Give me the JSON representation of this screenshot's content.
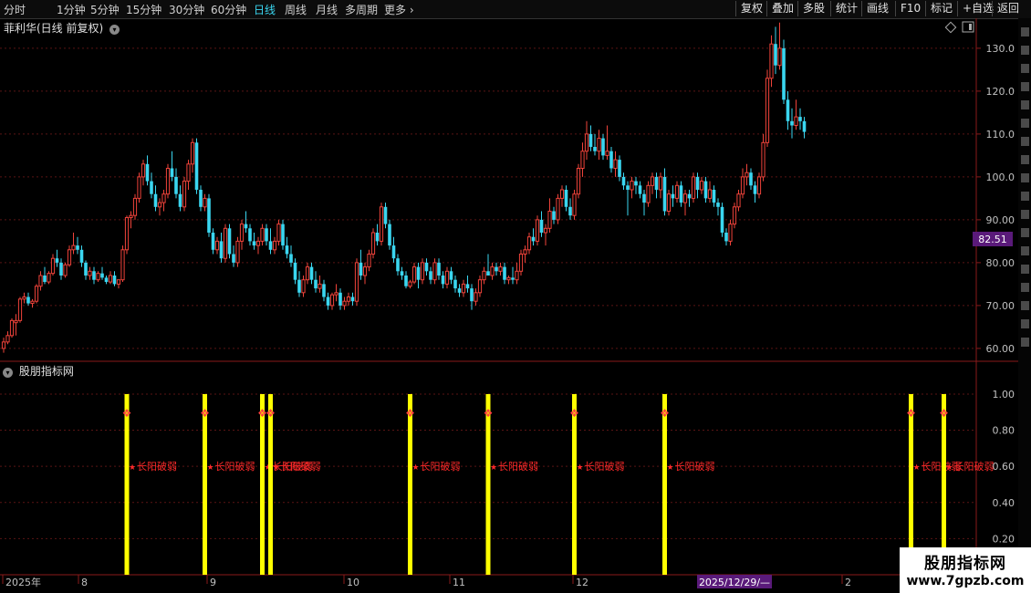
{
  "toolbar": {
    "periods": [
      {
        "label": "分时",
        "active": false
      },
      {
        "label": "1分钟",
        "active": false
      },
      {
        "label": "5分钟",
        "active": false
      },
      {
        "label": "15分钟",
        "active": false
      },
      {
        "label": "30分钟",
        "active": false
      },
      {
        "label": "60分钟",
        "active": false
      },
      {
        "label": "日线",
        "active": true
      },
      {
        "label": "周线",
        "active": false
      },
      {
        "label": "月线",
        "active": false
      },
      {
        "label": "多周期",
        "active": false
      },
      {
        "label": "更多",
        "active": false
      }
    ],
    "buttons": [
      "复权",
      "叠加",
      "多股",
      "统计",
      "画线",
      "F10",
      "标记",
      "+自选",
      "返回"
    ]
  },
  "main_panel": {
    "title": "菲利华(日线 前复权)",
    "price_tag": "82.51",
    "y_ticks": [
      "130.0",
      "120.0",
      "110.0",
      "100.0",
      "90.00",
      "80.00",
      "70.00",
      "60.00"
    ]
  },
  "indicator_panel": {
    "title": "股朋指标网",
    "y_ticks": [
      "1.00",
      "0.80",
      "0.60",
      "0.40",
      "0.20"
    ],
    "signal_label": "长阳破弱"
  },
  "x_axis": {
    "labels": [
      "2025年",
      "8",
      "9",
      "10",
      "11",
      "12",
      "2"
    ],
    "cursor_date": "2025/12/29/—"
  },
  "watermark": {
    "line1": "股朋指标网",
    "line2": "www.7gpzb.com"
  },
  "colors": {
    "up": "#f0433a",
    "down": "#3ad6f0",
    "signal_bar": "#ffff00",
    "signal_text": "#ff2a2a",
    "grid": "#5a1414",
    "axis_text": "#c0c0c0"
  },
  "chart_data": {
    "type": "candlestick",
    "ylim": [
      57,
      137
    ],
    "candles": [
      [
        60,
        62.5,
        59,
        61.5
      ],
      [
        61.5,
        64,
        61,
        63
      ],
      [
        63,
        67,
        62.5,
        66.5
      ],
      [
        66,
        68,
        63,
        66.5
      ],
      [
        66.5,
        72,
        66,
        71.5
      ],
      [
        71.5,
        73,
        70.5,
        72
      ],
      [
        72,
        73,
        70,
        70.5
      ],
      [
        70.5,
        71.5,
        69.5,
        71
      ],
      [
        71,
        75,
        70.5,
        74.5
      ],
      [
        74.5,
        78,
        73.5,
        77
      ],
      [
        77,
        79,
        75,
        75.5
      ],
      [
        75.5,
        78,
        75,
        77.5
      ],
      [
        77.5,
        82,
        77,
        81
      ],
      [
        81,
        83,
        79,
        80
      ],
      [
        80,
        81,
        76,
        77
      ],
      [
        77,
        80,
        76.5,
        79.5
      ],
      [
        79.5,
        84,
        79,
        83
      ],
      [
        83,
        87,
        82,
        84
      ],
      [
        84,
        86,
        82,
        83
      ],
      [
        83,
        84,
        79,
        80
      ],
      [
        80,
        80.5,
        76,
        77
      ],
      [
        77,
        79,
        76,
        78
      ],
      [
        78,
        79,
        75,
        76
      ],
      [
        76,
        78,
        75.5,
        77.5
      ],
      [
        77.5,
        79,
        76,
        76.5
      ],
      [
        76.5,
        77,
        75,
        75.5
      ],
      [
        75.5,
        78,
        75,
        77
      ],
      [
        77,
        78,
        74.5,
        75
      ],
      [
        75,
        76,
        74,
        76
      ],
      [
        76,
        84,
        75.5,
        83
      ],
      [
        83,
        91,
        82,
        90.5
      ],
      [
        90.5,
        92,
        88,
        91
      ],
      [
        91,
        96,
        90,
        95
      ],
      [
        95,
        101,
        94,
        100
      ],
      [
        100,
        104,
        98,
        103
      ],
      [
        103,
        105,
        98,
        99
      ],
      [
        99,
        101,
        95,
        96
      ],
      [
        96,
        98,
        92,
        93
      ],
      [
        93,
        95,
        91,
        94
      ],
      [
        94,
        97,
        92,
        96
      ],
      [
        96,
        103,
        95,
        102
      ],
      [
        102,
        106,
        99,
        100
      ],
      [
        100,
        102,
        95,
        96
      ],
      [
        96,
        98,
        92,
        93
      ],
      [
        93,
        100,
        92,
        99
      ],
      [
        99,
        104,
        97,
        103
      ],
      [
        103,
        109,
        101,
        108
      ],
      [
        108,
        109,
        96,
        97
      ],
      [
        97,
        98,
        92,
        93
      ],
      [
        93,
        96,
        92,
        95
      ],
      [
        95,
        96,
        86,
        87
      ],
      [
        87,
        88,
        82,
        83
      ],
      [
        83,
        86,
        82,
        85
      ],
      [
        85,
        87,
        80,
        81
      ],
      [
        81,
        89,
        80,
        88
      ],
      [
        88,
        89,
        81,
        82
      ],
      [
        82,
        84,
        79,
        80
      ],
      [
        80,
        86,
        79,
        85
      ],
      [
        85,
        90,
        83,
        89
      ],
      [
        89,
        92,
        87,
        88
      ],
      [
        88,
        89,
        84,
        85
      ],
      [
        85,
        87,
        83,
        84
      ],
      [
        84,
        86,
        82,
        85
      ],
      [
        85,
        89,
        84,
        88
      ],
      [
        88,
        89,
        84,
        85
      ],
      [
        85,
        88,
        82,
        83
      ],
      [
        83,
        86,
        82,
        85
      ],
      [
        85,
        90,
        84,
        89
      ],
      [
        89,
        90,
        83,
        84
      ],
      [
        84,
        86,
        81,
        82
      ],
      [
        82,
        84,
        79,
        80
      ],
      [
        80,
        81,
        75,
        76
      ],
      [
        76,
        78,
        72,
        73
      ],
      [
        73,
        77,
        72,
        76
      ],
      [
        76,
        80,
        75,
        79
      ],
      [
        79,
        80,
        75,
        76
      ],
      [
        76,
        78,
        73,
        74
      ],
      [
        74,
        77,
        73,
        75
      ],
      [
        75,
        76,
        71,
        72
      ],
      [
        72,
        73,
        69,
        70
      ],
      [
        70,
        73,
        69,
        72.5
      ],
      [
        72.5,
        75,
        71,
        73
      ],
      [
        73,
        74,
        69,
        70
      ],
      [
        70,
        72,
        69,
        71
      ],
      [
        71,
        73,
        70,
        72
      ],
      [
        72,
        73,
        70,
        71
      ],
      [
        71,
        81,
        70,
        80
      ],
      [
        80,
        83,
        76,
        77
      ],
      [
        77,
        80,
        75,
        79
      ],
      [
        79,
        83,
        78,
        82
      ],
      [
        82,
        88,
        81,
        87
      ],
      [
        87,
        89,
        84,
        85
      ],
      [
        85,
        94,
        84,
        93
      ],
      [
        93,
        94,
        88,
        89
      ],
      [
        89,
        90,
        83,
        84
      ],
      [
        84,
        86,
        80,
        81
      ],
      [
        81,
        82,
        77,
        78
      ],
      [
        78,
        79,
        76,
        77
      ],
      [
        77,
        78,
        74,
        74.5
      ],
      [
        74.5,
        76,
        74,
        75.5
      ],
      [
        75.5,
        80,
        75,
        79
      ],
      [
        79,
        80,
        74,
        76
      ],
      [
        76,
        81,
        75,
        80
      ],
      [
        80,
        81,
        77,
        78
      ],
      [
        78,
        79,
        75,
        76
      ],
      [
        76,
        81,
        75,
        80
      ],
      [
        80,
        81,
        76,
        77
      ],
      [
        77,
        78,
        74,
        75
      ],
      [
        75,
        79,
        74,
        78
      ],
      [
        78,
        79,
        75,
        76
      ],
      [
        76,
        77,
        73,
        74
      ],
      [
        74,
        75,
        72,
        73
      ],
      [
        73,
        76,
        72,
        75
      ],
      [
        75,
        77,
        73,
        74
      ],
      [
        74,
        75,
        69,
        71
      ],
      [
        71,
        74,
        70,
        73
      ],
      [
        73,
        77,
        72,
        76
      ],
      [
        76,
        79,
        75,
        78
      ],
      [
        78,
        82,
        77,
        77
      ],
      [
        77,
        80,
        76,
        79
      ],
      [
        79,
        80,
        77,
        78
      ],
      [
        78,
        80,
        77,
        79
      ],
      [
        79,
        80,
        75,
        76
      ],
      [
        76,
        77,
        75,
        76.5
      ],
      [
        76.5,
        79,
        75,
        76
      ],
      [
        76,
        80,
        75,
        78
      ],
      [
        78,
        83,
        77,
        82
      ],
      [
        82,
        84,
        80,
        83
      ],
      [
        83,
        87,
        82,
        86
      ],
      [
        86,
        88,
        84,
        85
      ],
      [
        85,
        91,
        84,
        90
      ],
      [
        90,
        92,
        86,
        87
      ],
      [
        87,
        89,
        84,
        88
      ],
      [
        88,
        95,
        87,
        92
      ],
      [
        92,
        93,
        89,
        90
      ],
      [
        90,
        96,
        89,
        95
      ],
      [
        95,
        98,
        93,
        97
      ],
      [
        97,
        98,
        92,
        93
      ],
      [
        93,
        95,
        90,
        91
      ],
      [
        91,
        97,
        90,
        96
      ],
      [
        96,
        103,
        95,
        102
      ],
      [
        102,
        108,
        100,
        106
      ],
      [
        106,
        113,
        104,
        110
      ],
      [
        110,
        112,
        106,
        107
      ],
      [
        107,
        110,
        105,
        106
      ],
      [
        106,
        111,
        104,
        109
      ],
      [
        109,
        110,
        104,
        105
      ],
      [
        105,
        112,
        104,
        106
      ],
      [
        106,
        107,
        101,
        102
      ],
      [
        102,
        106,
        100,
        104
      ],
      [
        104,
        105,
        99,
        100
      ],
      [
        100,
        101,
        97,
        98
      ],
      [
        98,
        99,
        91,
        97
      ],
      [
        97,
        100,
        95,
        99
      ],
      [
        99,
        100,
        96,
        98
      ],
      [
        98,
        99,
        95,
        96
      ],
      [
        96,
        97,
        91,
        94
      ],
      [
        94,
        99,
        93,
        98
      ],
      [
        98,
        101,
        96,
        100
      ],
      [
        100,
        101,
        95,
        97
      ],
      [
        97,
        101,
        95,
        100
      ],
      [
        100,
        102,
        91,
        92
      ],
      [
        92,
        97,
        91,
        96
      ],
      [
        96,
        98,
        93,
        95
      ],
      [
        95,
        99,
        94,
        98
      ],
      [
        98,
        99,
        93,
        94
      ],
      [
        94,
        97,
        91,
        96
      ],
      [
        96,
        97,
        93,
        95
      ],
      [
        95,
        101,
        94,
        100
      ],
      [
        100,
        101,
        95,
        97
      ],
      [
        97,
        100,
        96,
        99
      ],
      [
        99,
        100,
        94,
        95
      ],
      [
        95,
        99,
        94,
        97
      ],
      [
        97,
        98,
        93,
        94
      ],
      [
        94,
        95,
        91,
        93
      ],
      [
        93,
        94,
        86,
        87
      ],
      [
        87,
        88,
        84,
        85
      ],
      [
        85,
        90,
        84,
        89
      ],
      [
        89,
        94,
        88,
        93
      ],
      [
        93,
        97,
        92,
        96
      ],
      [
        96,
        102,
        95,
        100
      ],
      [
        100,
        103,
        98,
        101
      ],
      [
        101,
        102,
        97,
        98
      ],
      [
        98,
        99,
        94,
        96
      ],
      [
        96,
        101,
        95,
        100
      ],
      [
        100,
        110,
        99,
        108
      ],
      [
        108,
        125,
        107,
        123
      ],
      [
        123,
        133,
        121,
        131
      ],
      [
        131,
        135,
        124,
        126
      ],
      [
        126,
        136,
        125,
        130
      ],
      [
        130,
        132,
        117,
        118
      ],
      [
        118,
        120,
        111,
        113
      ],
      [
        113,
        116,
        109,
        112
      ],
      [
        112,
        118,
        111,
        114
      ],
      [
        114,
        116,
        111,
        113
      ],
      [
        113,
        114,
        109,
        110.5
      ]
    ],
    "signals": [
      {
        "candle": 30,
        "value": 1.0
      },
      {
        "candle": 49,
        "value": 1.0
      },
      {
        "candle": 63,
        "value": 1.0
      },
      {
        "candle": 65,
        "value": 1.0
      },
      {
        "candle": 99,
        "value": 1.0
      },
      {
        "candle": 118,
        "value": 1.0
      },
      {
        "candle": 139,
        "value": 1.0
      },
      {
        "candle": 161,
        "value": 1.0
      },
      {
        "candle": 221,
        "value": 1.0
      },
      {
        "candle": 229,
        "value": 1.0
      }
    ]
  }
}
